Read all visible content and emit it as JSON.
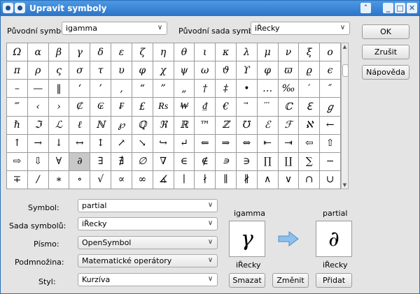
{
  "window": {
    "title": "Upravit symboly"
  },
  "top": {
    "old_symbol_label": "Původní symbol:",
    "old_symbol_value": "igamma",
    "old_set_label": "Původní sada symbolů:",
    "old_set_value": "iŘecky"
  },
  "grid": {
    "cells": [
      "Ω",
      "α",
      "β",
      "γ",
      "δ",
      "ε",
      "ζ",
      "η",
      "θ",
      "ι",
      "κ",
      "λ",
      "μ",
      "ν",
      "ξ",
      "ο",
      "π",
      "ρ",
      "ς",
      "σ",
      "τ",
      "υ",
      "φ",
      "χ",
      "ψ",
      "ω",
      "ϑ",
      "ϒ",
      "φ",
      "ϖ",
      "ϱ",
      "ϵ",
      "–",
      "—",
      "‖",
      "‘",
      "’",
      "‚",
      "“",
      "”",
      "„",
      "†",
      "‡",
      "•",
      "…",
      "‰",
      "′",
      "″",
      "‴",
      "‹",
      "›",
      "₡",
      "₢",
      "₣",
      "£",
      "₨",
      "₩",
      "₫",
      "€",
      "⃗",
      "⃛",
      "ℂ",
      "ℇ",
      "ℊ",
      "ℏ",
      "ℑ",
      "ℒ",
      "ℓ",
      "ℕ",
      "℘",
      "ℚ",
      "ℜ",
      "ℝ",
      "™",
      "ℤ",
      "℧",
      "ℰ",
      "ℱ",
      "ℵ",
      "←",
      "↑",
      "→",
      "↓",
      "↔",
      "↕",
      "↗",
      "↘",
      "↪",
      "↵",
      "⇐",
      "⇒",
      "⇔",
      "⇤",
      "⇥",
      "⇦",
      "⇧",
      "⇨",
      "⇩",
      "∀",
      "∂",
      "∃",
      "∄",
      "∅",
      "∇",
      "∈",
      "∉",
      "∍",
      "∋",
      "∏",
      "∐",
      "∑",
      "−",
      "∓",
      "∕",
      "∗",
      "∘",
      "√",
      "∝",
      "∞",
      "∡",
      "∣",
      "∤",
      "∥",
      "∦",
      "∧",
      "∨",
      "∩",
      "∪"
    ],
    "selected_index": 99
  },
  "form": {
    "symbol_label": "Symbol:",
    "symbol_value": "partial",
    "set_label": "Sada symbolů:",
    "set_value": "iŘecky",
    "font_label": "Písmo:",
    "font_value": "OpenSymbol",
    "subset_label": "Podmnožina:",
    "subset_value": "Matematické operátory",
    "style_label": "Styl:",
    "style_value": "Kurzíva"
  },
  "preview": {
    "old_name": "igamma",
    "old_glyph": "γ",
    "old_set": "iŘecky",
    "new_name": "partial",
    "new_glyph": "∂",
    "new_set": "iŘecky"
  },
  "buttons": {
    "ok": "OK",
    "cancel": "Zrušit",
    "help": "Nápověda",
    "delete": "Smazat",
    "modify": "Změnit",
    "add": "Přidat"
  },
  "icons": [
    "app-icon",
    "pin-icon",
    "chevron-up-icon",
    "minimize-icon",
    "maximize-icon",
    "close-icon",
    "dropdown-arrow-icon",
    "arrow-right-icon"
  ],
  "colors": {
    "titlebar": "#2b74c7",
    "arrow": "#5a9ad6"
  }
}
